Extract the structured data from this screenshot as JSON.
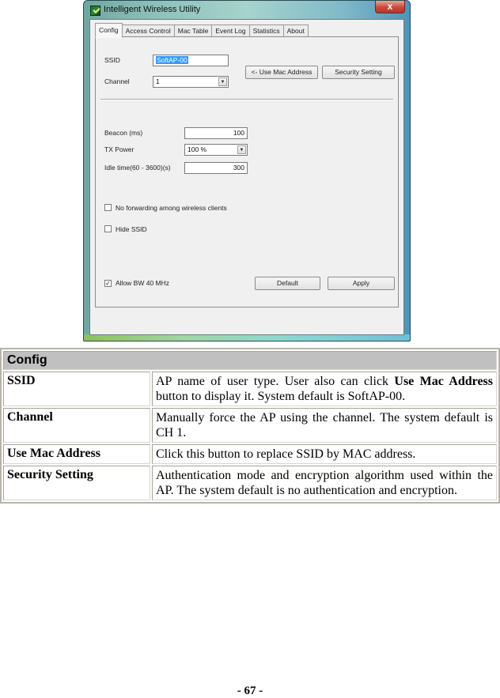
{
  "window": {
    "title": "Intelligent Wireless Utility",
    "close_label": "x",
    "tabs": [
      {
        "label": "Config",
        "active": true
      },
      {
        "label": "Access Control",
        "active": false
      },
      {
        "label": "Mac Table",
        "active": false
      },
      {
        "label": "Event Log",
        "active": false
      },
      {
        "label": "Statistics",
        "active": false
      },
      {
        "label": "About",
        "active": false
      }
    ],
    "config": {
      "ssid_label": "SSID",
      "ssid_value": "SoftAP-00",
      "channel_label": "Channel",
      "channel_value": "1",
      "use_mac_button": "<- Use Mac Address",
      "security_button": "Security Setting",
      "beacon_label": "Beacon (ms)",
      "beacon_value": "100",
      "txpower_label": "TX Power",
      "txpower_value": "100 %",
      "idle_label": "Idle time(60 - 3600)(s)",
      "idle_value": "300",
      "no_forwarding_label": "No forwarding among wireless clients",
      "no_forwarding_checked": false,
      "hide_ssid_label": "Hide SSID",
      "hide_ssid_checked": false,
      "allow_bw_label": "Allow BW 40 MHz",
      "allow_bw_checked": true,
      "default_button": "Default",
      "apply_button": "Apply"
    }
  },
  "doc_table": {
    "header": "Config",
    "rows": [
      {
        "term": "SSID",
        "desc_parts": [
          "AP name of user type. User also can click ",
          "Use Mac Address",
          " button to display it. System default is SoftAP-00."
        ]
      },
      {
        "term": "Channel",
        "desc": "Manually force the AP using the channel. The system default is CH 1."
      },
      {
        "term": "Use Mac Address",
        "desc": "Click this button to replace SSID by MAC address."
      },
      {
        "term": "Security Setting",
        "desc": "Authentication mode and encryption algorithm used within the AP. The system default is no authentication and encryption."
      }
    ]
  },
  "page_number": "- 67 -"
}
